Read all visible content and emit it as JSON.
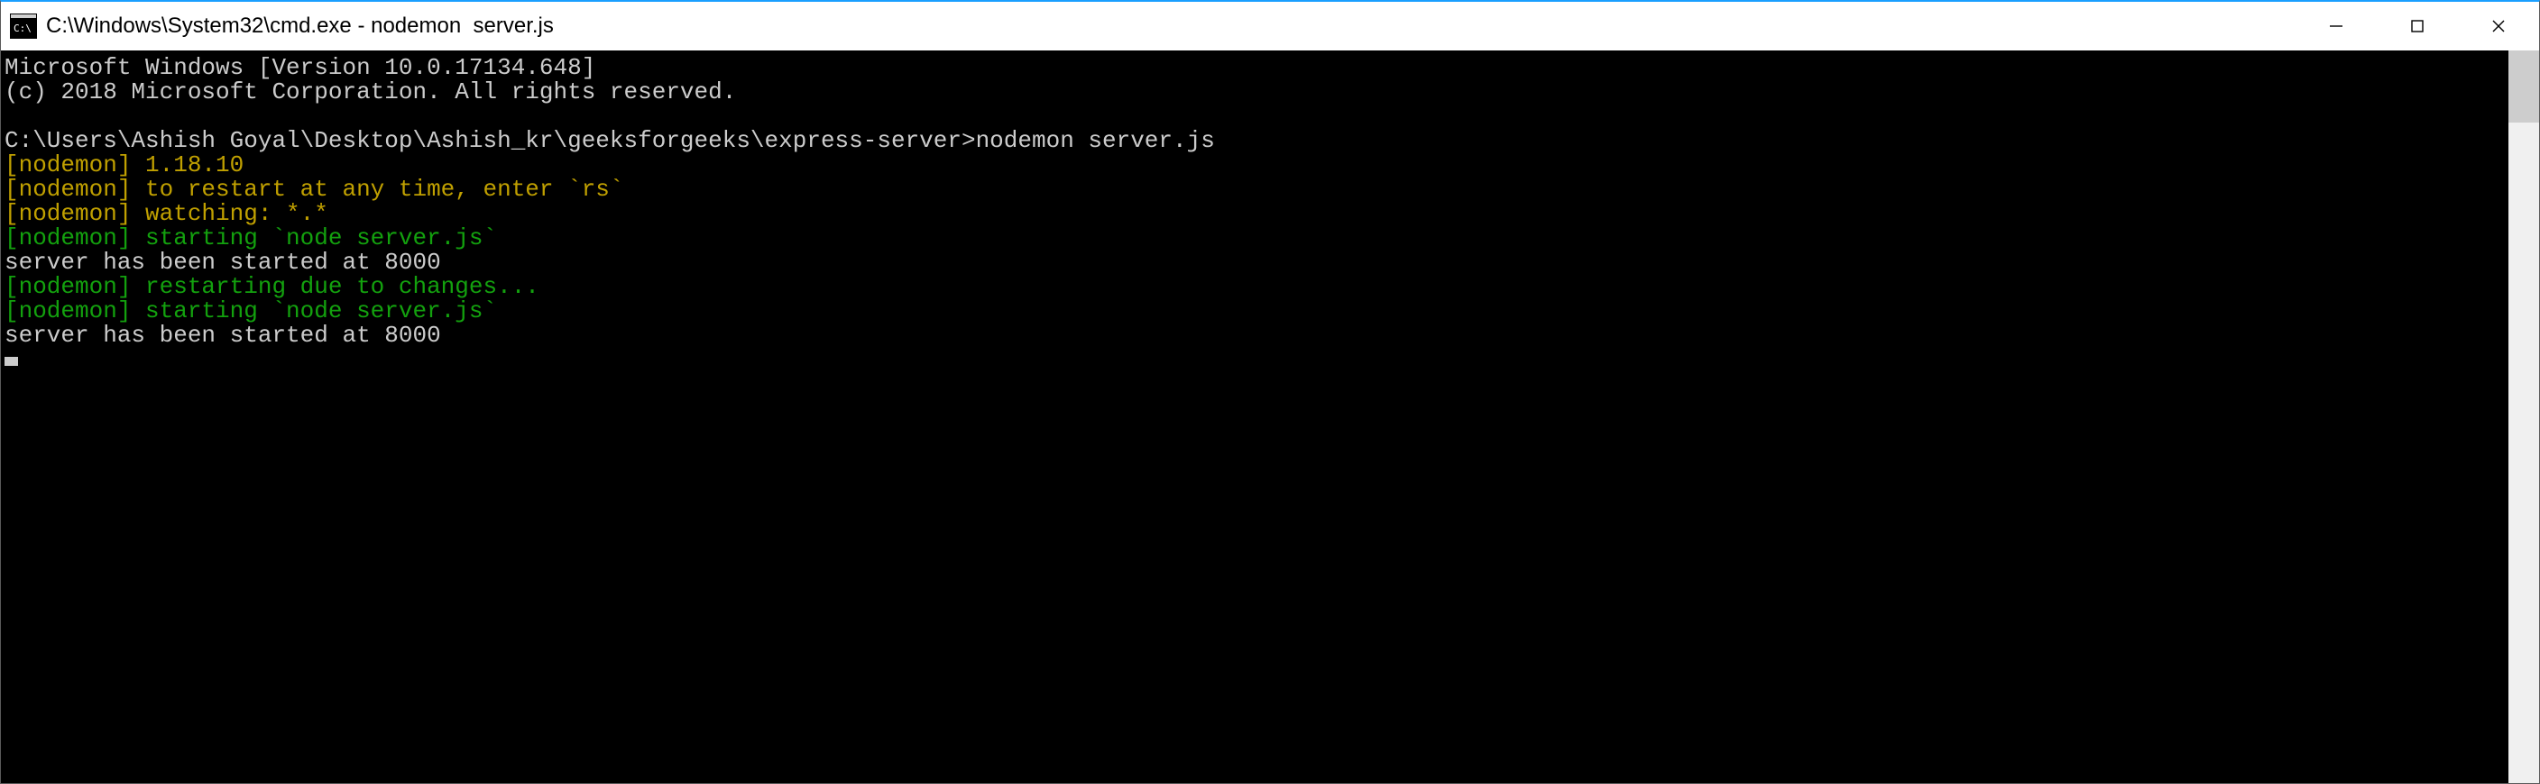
{
  "window": {
    "title": "C:\\Windows\\System32\\cmd.exe - nodemon  server.js",
    "minimize_label": "Minimize",
    "maximize_label": "Maximize",
    "close_label": "Close"
  },
  "terminal": {
    "lines": [
      {
        "text": "Microsoft Windows [Version 10.0.17134.648]",
        "color": "white"
      },
      {
        "text": "(c) 2018 Microsoft Corporation. All rights reserved.",
        "color": "white"
      },
      {
        "text": "",
        "color": "white"
      },
      {
        "text": "C:\\Users\\Ashish Goyal\\Desktop\\Ashish_kr\\geeksforgeeks\\express-server>nodemon server.js",
        "color": "white"
      },
      {
        "text": "[nodemon] 1.18.10",
        "color": "yellow"
      },
      {
        "text": "[nodemon] to restart at any time, enter `rs`",
        "color": "yellow"
      },
      {
        "text": "[nodemon] watching: *.*",
        "color": "yellow"
      },
      {
        "text": "[nodemon] starting `node server.js`",
        "color": "green"
      },
      {
        "text": "server has been started at 8000",
        "color": "white"
      },
      {
        "text": "[nodemon] restarting due to changes...",
        "color": "green"
      },
      {
        "text": "[nodemon] starting `node server.js`",
        "color": "green"
      },
      {
        "text": "server has been started at 8000",
        "color": "white"
      }
    ]
  }
}
